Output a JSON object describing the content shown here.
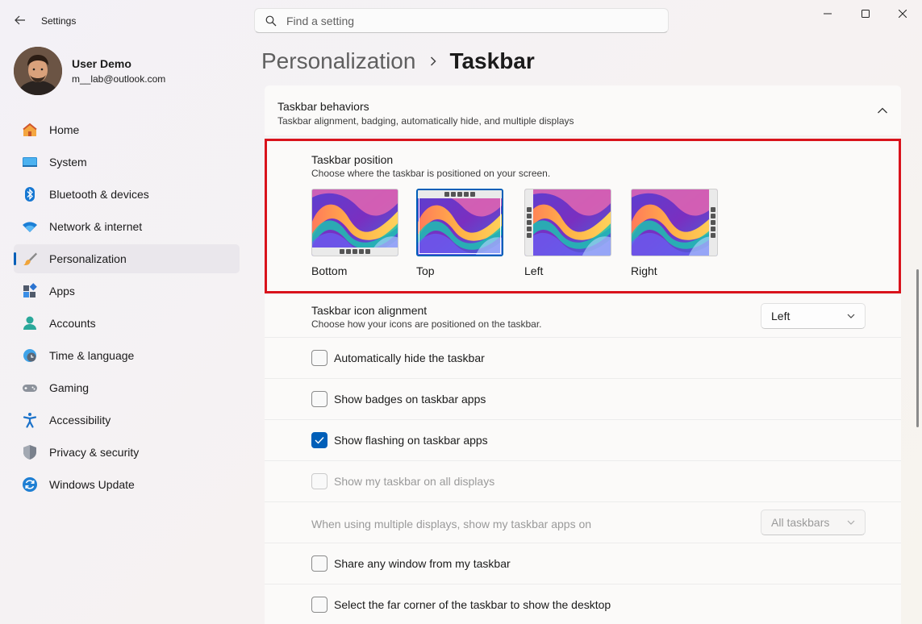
{
  "window": {
    "app_title": "Settings",
    "search_placeholder": "Find a setting"
  },
  "profile": {
    "name": "User Demo",
    "email": "m__lab@outlook.com"
  },
  "sidebar": {
    "items": [
      {
        "label": "Home",
        "icon": "home-icon"
      },
      {
        "label": "System",
        "icon": "system-icon"
      },
      {
        "label": "Bluetooth & devices",
        "icon": "bluetooth-icon"
      },
      {
        "label": "Network & internet",
        "icon": "wifi-icon"
      },
      {
        "label": "Personalization",
        "icon": "brush-icon",
        "active": true
      },
      {
        "label": "Apps",
        "icon": "apps-icon"
      },
      {
        "label": "Accounts",
        "icon": "accounts-icon"
      },
      {
        "label": "Time & language",
        "icon": "clock-globe-icon"
      },
      {
        "label": "Gaming",
        "icon": "gamepad-icon"
      },
      {
        "label": "Accessibility",
        "icon": "accessibility-icon"
      },
      {
        "label": "Privacy & security",
        "icon": "shield-icon"
      },
      {
        "label": "Windows Update",
        "icon": "update-icon"
      }
    ]
  },
  "breadcrumb": {
    "parent": "Personalization",
    "current": "Taskbar"
  },
  "behaviors": {
    "title": "Taskbar behaviors",
    "subtitle": "Taskbar alignment, badging, automatically hide, and multiple displays",
    "position": {
      "title": "Taskbar position",
      "subtitle": "Choose where the taskbar is positioned on your screen.",
      "options": [
        {
          "label": "Bottom",
          "selected": false
        },
        {
          "label": "Top",
          "selected": true
        },
        {
          "label": "Left",
          "selected": false
        },
        {
          "label": "Right",
          "selected": false
        }
      ]
    },
    "alignment": {
      "title": "Taskbar icon alignment",
      "subtitle": "Choose how your icons are positioned on the taskbar.",
      "value": "Left"
    },
    "checkboxes": {
      "auto_hide": {
        "label": "Automatically hide the taskbar",
        "checked": false
      },
      "badges": {
        "label": "Show badges on taskbar apps",
        "checked": false
      },
      "flashing": {
        "label": "Show flashing on taskbar apps",
        "checked": true
      },
      "all_displays": {
        "label": "Show my taskbar on all displays",
        "checked": false,
        "disabled": true
      },
      "share_window": {
        "label": "Share any window from my taskbar",
        "checked": false
      },
      "far_corner": {
        "label": "Select the far corner of the taskbar to show the desktop",
        "checked": false
      }
    },
    "multi_display": {
      "label": "When using multiple displays, show my taskbar apps on",
      "value": "All taskbars",
      "disabled": true
    }
  },
  "colors": {
    "accent": "#005fb8",
    "highlight_border": "#d9131c"
  }
}
